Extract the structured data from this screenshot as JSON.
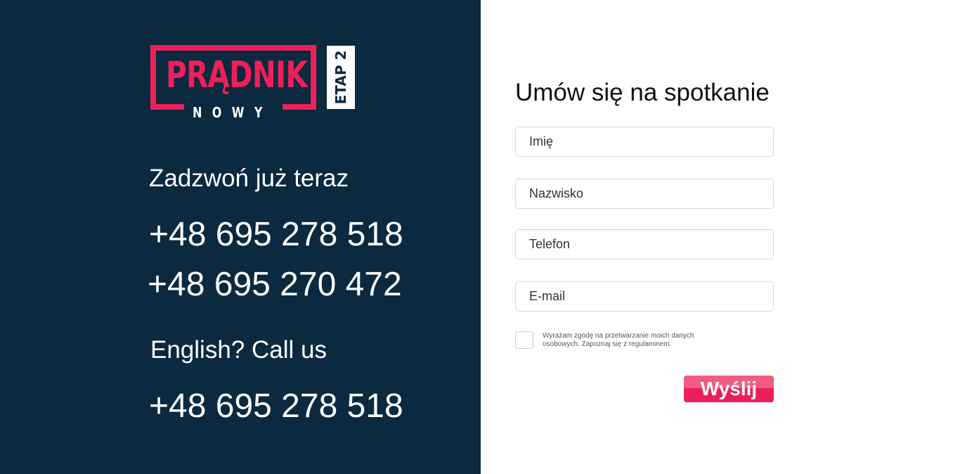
{
  "logo": {
    "word": "PRĄDNIK",
    "sub": "NOWY",
    "badge": "ETAP 2"
  },
  "contact": {
    "call_heading": "Zadzwoń już teraz",
    "phones": [
      "+48 695 278 518",
      "+48 695 270 472"
    ],
    "english_heading": "English? Call us",
    "english_phone": "+48 695 278 518"
  },
  "form": {
    "title": "Umów się na spotkanie",
    "name_placeholder": "Imię",
    "surname_placeholder": "Nazwisko",
    "phone_placeholder": "Telefon",
    "email_placeholder": "E-mail",
    "consent_text": "Wyrażam zgodę na przetwarzanie moich danych osobowych. Zapoznaj się z regulaminem.",
    "submit_label": "Wyślij"
  },
  "colors": {
    "left_panel_bg": "#0b293f",
    "brand_pink": "#ef1f5b",
    "text_light": "#ffffff"
  }
}
